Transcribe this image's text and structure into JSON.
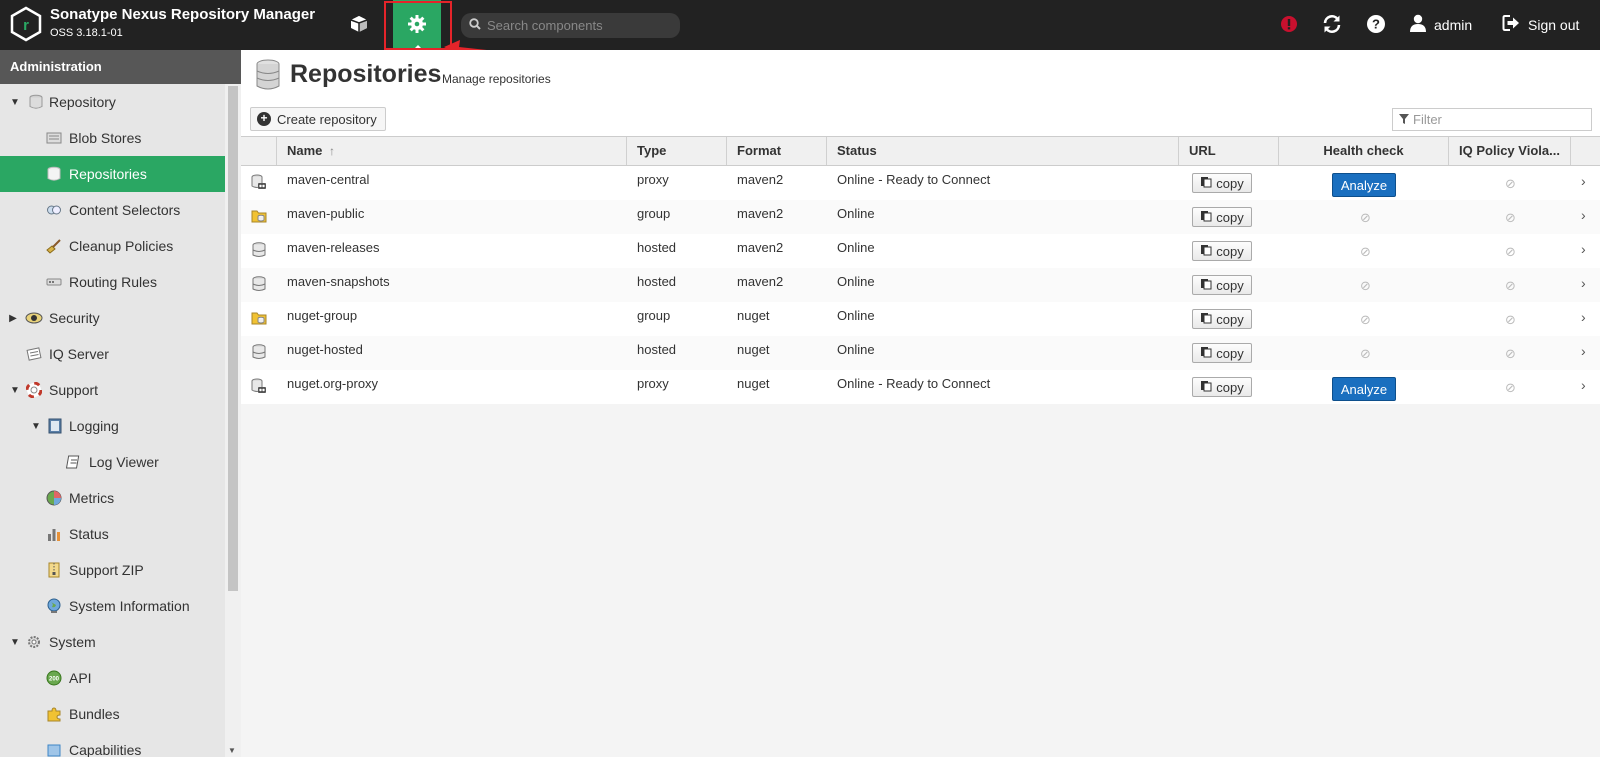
{
  "app": {
    "title": "Sonatype Nexus Repository Manager",
    "version": "OSS 3.18.1-01"
  },
  "topbar": {
    "search_placeholder": "Search components",
    "user": "admin",
    "signout": "Sign out"
  },
  "sidebar": {
    "header": "Administration",
    "items": [
      {
        "label": "Repository",
        "icon": "database-icon"
      },
      {
        "label": "Blob Stores",
        "icon": "blob-store-icon"
      },
      {
        "label": "Repositories",
        "icon": "database-icon",
        "active": true
      },
      {
        "label": "Content Selectors",
        "icon": "content-selector-icon"
      },
      {
        "label": "Cleanup Policies",
        "icon": "broom-icon"
      },
      {
        "label": "Routing Rules",
        "icon": "routing-icon"
      },
      {
        "label": "Security",
        "icon": "security-icon"
      },
      {
        "label": "IQ Server",
        "icon": "iq-server-icon"
      },
      {
        "label": "Support",
        "icon": "lifebuoy-icon"
      },
      {
        "label": "Logging",
        "icon": "book-icon"
      },
      {
        "label": "Log Viewer",
        "icon": "log-icon"
      },
      {
        "label": "Metrics",
        "icon": "pie-chart-icon"
      },
      {
        "label": "Status",
        "icon": "bar-chart-icon"
      },
      {
        "label": "Support ZIP",
        "icon": "zip-icon"
      },
      {
        "label": "System Information",
        "icon": "globe-icon"
      },
      {
        "label": "System",
        "icon": "gear-icon"
      },
      {
        "label": "API",
        "icon": "api-icon"
      },
      {
        "label": "Bundles",
        "icon": "puzzle-icon"
      },
      {
        "label": "Capabilities",
        "icon": "capabilities-icon"
      }
    ]
  },
  "page": {
    "title": "Repositories",
    "subtitle": "Manage repositories",
    "create_label": "Create repository",
    "filter_placeholder": "Filter"
  },
  "table": {
    "columns": {
      "name": "Name",
      "type": "Type",
      "format": "Format",
      "status": "Status",
      "url": "URL",
      "health": "Health check",
      "iq": "IQ Policy Viola..."
    },
    "copy_label": "copy",
    "analyze_label": "Analyze",
    "rows": [
      {
        "name": "maven-central",
        "type": "proxy",
        "format": "maven2",
        "status": "Online - Ready to Connect",
        "analyze": true
      },
      {
        "name": "maven-public",
        "type": "group",
        "format": "maven2",
        "status": "Online",
        "analyze": false
      },
      {
        "name": "maven-releases",
        "type": "hosted",
        "format": "maven2",
        "status": "Online",
        "analyze": false
      },
      {
        "name": "maven-snapshots",
        "type": "hosted",
        "format": "maven2",
        "status": "Online",
        "analyze": false
      },
      {
        "name": "nuget-group",
        "type": "group",
        "format": "nuget",
        "status": "Online",
        "analyze": false
      },
      {
        "name": "nuget-hosted",
        "type": "hosted",
        "format": "nuget",
        "status": "Online",
        "analyze": false
      },
      {
        "name": "nuget.org-proxy",
        "type": "proxy",
        "format": "nuget",
        "status": "Online - Ready to Connect",
        "analyze": true
      }
    ]
  },
  "colors": {
    "accent": "#2aa763",
    "topbar": "#222222",
    "highlight": "#e5242a",
    "analyze": "#1a6fbf"
  }
}
